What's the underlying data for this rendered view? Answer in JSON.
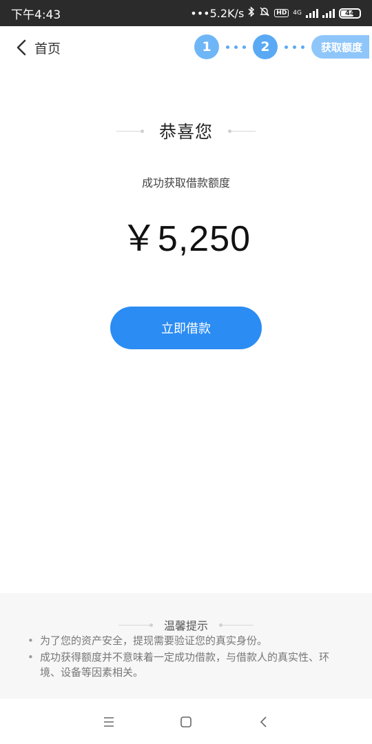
{
  "status_bar": {
    "time": "下午4:43",
    "network_speed": "•••5.2K/s",
    "network_type": "4G",
    "hd_label": "HD",
    "battery": "44"
  },
  "nav": {
    "back_label": "首页",
    "steps": [
      "1",
      "2"
    ],
    "current_step_label": "获取额度"
  },
  "main": {
    "title": "恭喜您",
    "subtitle": "成功获取借款额度",
    "amount": "￥5,250",
    "button_label": "立即借款"
  },
  "tips": {
    "title": "温馨提示",
    "items": [
      "为了您的资产安全，提现需要验证您的真实身份。",
      "成功获得额度并不意味着一定成功借款，与借款人的真实性、环境、设备等因素相关。"
    ]
  },
  "colors": {
    "accent": "#2b8cf3",
    "step": "#5aa9f5"
  }
}
